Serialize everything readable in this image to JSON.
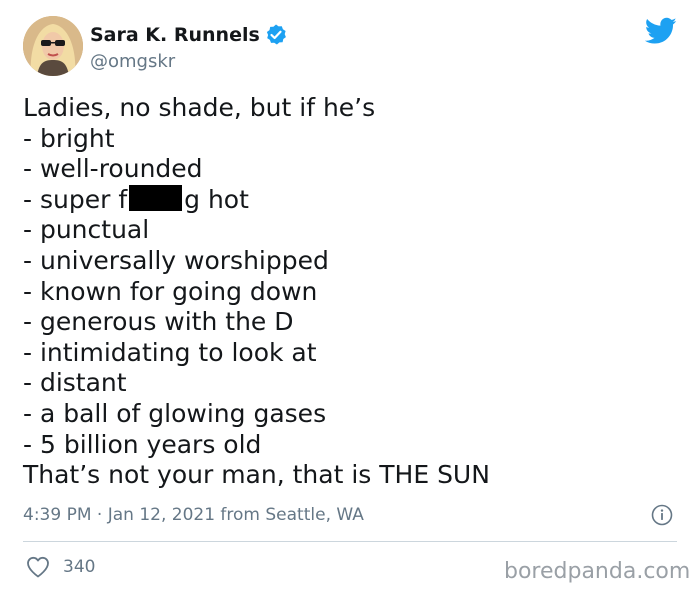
{
  "author": {
    "display_name": "Sara K. Runnels",
    "handle": "@omgskr",
    "verified": true
  },
  "tweet": {
    "lines": [
      "Ladies, no shade, but if he’s",
      "- bright",
      "- well-rounded",
      {
        "before": "- super f",
        "redacted": true,
        "after": "g hot"
      },
      "- punctual",
      "- universally worshipped",
      "- known for going down",
      "- generous with the D",
      "- intimidating to look at",
      "- distant",
      "- a ball of glowing gases",
      "- 5 billion years old",
      "That’s not your man, that is THE SUN"
    ]
  },
  "meta": {
    "timestamp": "4:39 PM · Jan 12, 2021 from Seattle, WA"
  },
  "stats": {
    "likes": "340"
  },
  "watermark": "boredpanda.com",
  "colors": {
    "twitter_blue": "#1da1f2",
    "secondary_text": "#657786",
    "divider": "#ccd6dd",
    "text": "#14171a"
  },
  "icons": {
    "verified": "verified-badge-icon",
    "logo": "twitter-bird-icon",
    "info": "info-circle-icon",
    "like": "heart-outline-icon"
  }
}
